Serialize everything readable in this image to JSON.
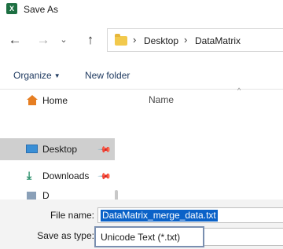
{
  "window": {
    "title": "Save As",
    "app_icon": "excel-icon",
    "app_icon_letter": "X"
  },
  "nav": {
    "back_glyph": "←",
    "forward_glyph": "→",
    "history_glyph": "⌄",
    "up_glyph": "↑"
  },
  "address": {
    "breadcrumbs": [
      "Desktop",
      "DataMatrix"
    ],
    "separator": "›"
  },
  "toolbar": {
    "organize_label": "Organize",
    "organize_caret": "▼",
    "new_folder_label": "New folder"
  },
  "sidebar": {
    "items": [
      {
        "label": "Home",
        "icon": "home-icon"
      },
      {
        "label": "Desktop",
        "icon": "desktop-icon",
        "selected": true,
        "pinned": true
      },
      {
        "label": "Downloads",
        "icon": "downloads-icon",
        "pinned": true
      },
      {
        "label": "D",
        "icon": "partial-icon"
      }
    ],
    "pin_glyph": "📌"
  },
  "content": {
    "columns": [
      "Name"
    ],
    "sort_caret": "^"
  },
  "bottom": {
    "file_name_label": "File name:",
    "file_name_value": "DataMatrix_merge_data.txt",
    "save_as_type_label": "Save as type:",
    "save_as_type_value": "Unicode Text (*.txt)"
  },
  "colors": {
    "selection": "#0b62c8",
    "sidebar_selected": "#cfcfcf",
    "focus_border": "#7a8fb0",
    "excel_green": "#1d6f42",
    "folder_yellow": "#f2c94c"
  }
}
